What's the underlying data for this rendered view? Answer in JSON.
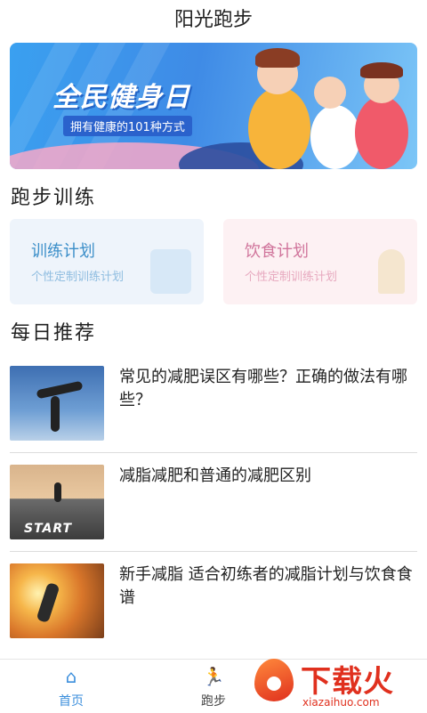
{
  "appbar": {
    "title": "阳光跑步"
  },
  "banner": {
    "headline": "全民健身日",
    "subline": "拥有健康的101种方式"
  },
  "training": {
    "section_title": "跑步训练",
    "cards": [
      {
        "title": "训练计划",
        "subtitle": "个性定制训练计划"
      },
      {
        "title": "饮食计划",
        "subtitle": "个性定制训练计划"
      }
    ]
  },
  "daily": {
    "section_title": "每日推荐",
    "articles": [
      {
        "title": "常见的减肥误区有哪些？正确的做法有哪些？"
      },
      {
        "title": "减脂减肥和普通的减肥区别",
        "thumb_text": "START"
      },
      {
        "title": "新手减脂 适合初练者的减脂计划与饮食食谱"
      }
    ]
  },
  "tabbar": {
    "tabs": [
      {
        "label": "首页",
        "icon": "home-icon",
        "active": true
      },
      {
        "label": "跑步",
        "icon": "running-icon",
        "active": false
      }
    ]
  },
  "watermark": {
    "brand": "下载火",
    "url": "xiazaihuo.com"
  },
  "colors": {
    "accent": "#3c8fdc",
    "banner": "#3f8be6",
    "train": "#3c8fc9",
    "diet": "#d0749b",
    "watermark": "#e0301e"
  }
}
